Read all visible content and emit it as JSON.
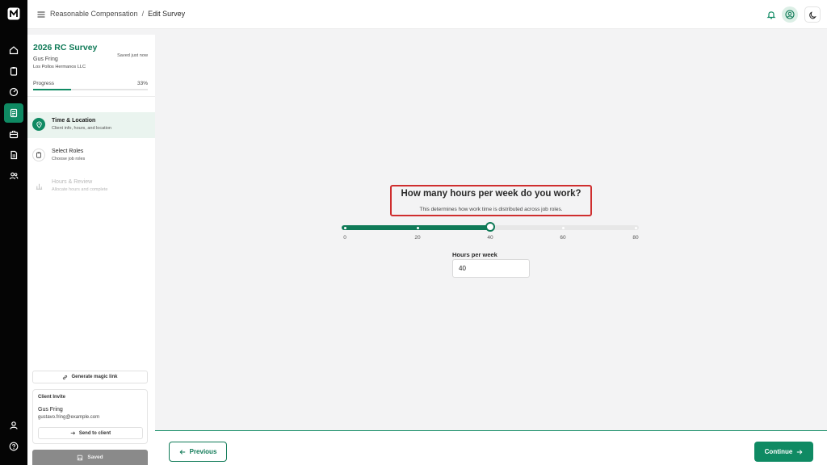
{
  "breadcrumb": {
    "parent": "Reasonable Compensation",
    "separator": "/",
    "current": "Edit Survey"
  },
  "rail": {
    "top_items": [
      "home-icon",
      "clipboard-icon",
      "gauge-icon",
      "survey-icon",
      "briefcase-icon",
      "document-icon",
      "users-icon"
    ],
    "active_item": "survey-icon",
    "bottom_items": [
      "profile-icon",
      "help-icon"
    ]
  },
  "survey": {
    "title": "2026 RC Survey",
    "client": "Gus Fring",
    "company": "Los Pollos Hermanos LLC",
    "saved_status": "Saved just now",
    "progress_label": "Progress",
    "progress_text": "33%",
    "progress_value": 0.33
  },
  "steps": [
    {
      "title": "Time & Location",
      "subtitle": "Client info, hours, and location",
      "state": "active"
    },
    {
      "title": "Select Roles",
      "subtitle": "Choose job roles",
      "state": "upcoming"
    },
    {
      "title": "Hours & Review",
      "subtitle": "Allocate hours and complete",
      "state": "disabled"
    }
  ],
  "magic_link_label": "Generate magic link",
  "invite": {
    "heading": "Client Invite",
    "name": "Gus Fring",
    "email": "gustavo.fring@example.com",
    "send_label": "Send to client"
  },
  "saved_label": "Saved",
  "question": {
    "title": "How many hours per week do you work?",
    "subtitle": "This determines how work time is distributed across job roles."
  },
  "slider": {
    "min": 0,
    "max": 80,
    "value": 40,
    "ticks": [
      "0",
      "20",
      "40",
      "60",
      "80"
    ]
  },
  "hours_field": {
    "label": "Hours per week",
    "value": "40"
  },
  "nav": {
    "previous_label": "Previous",
    "continue_label": "Continue"
  },
  "colors": {
    "accent": "#0f8a63",
    "accent_dark": "#0f7a57",
    "highlight": "#cf2e2e"
  }
}
